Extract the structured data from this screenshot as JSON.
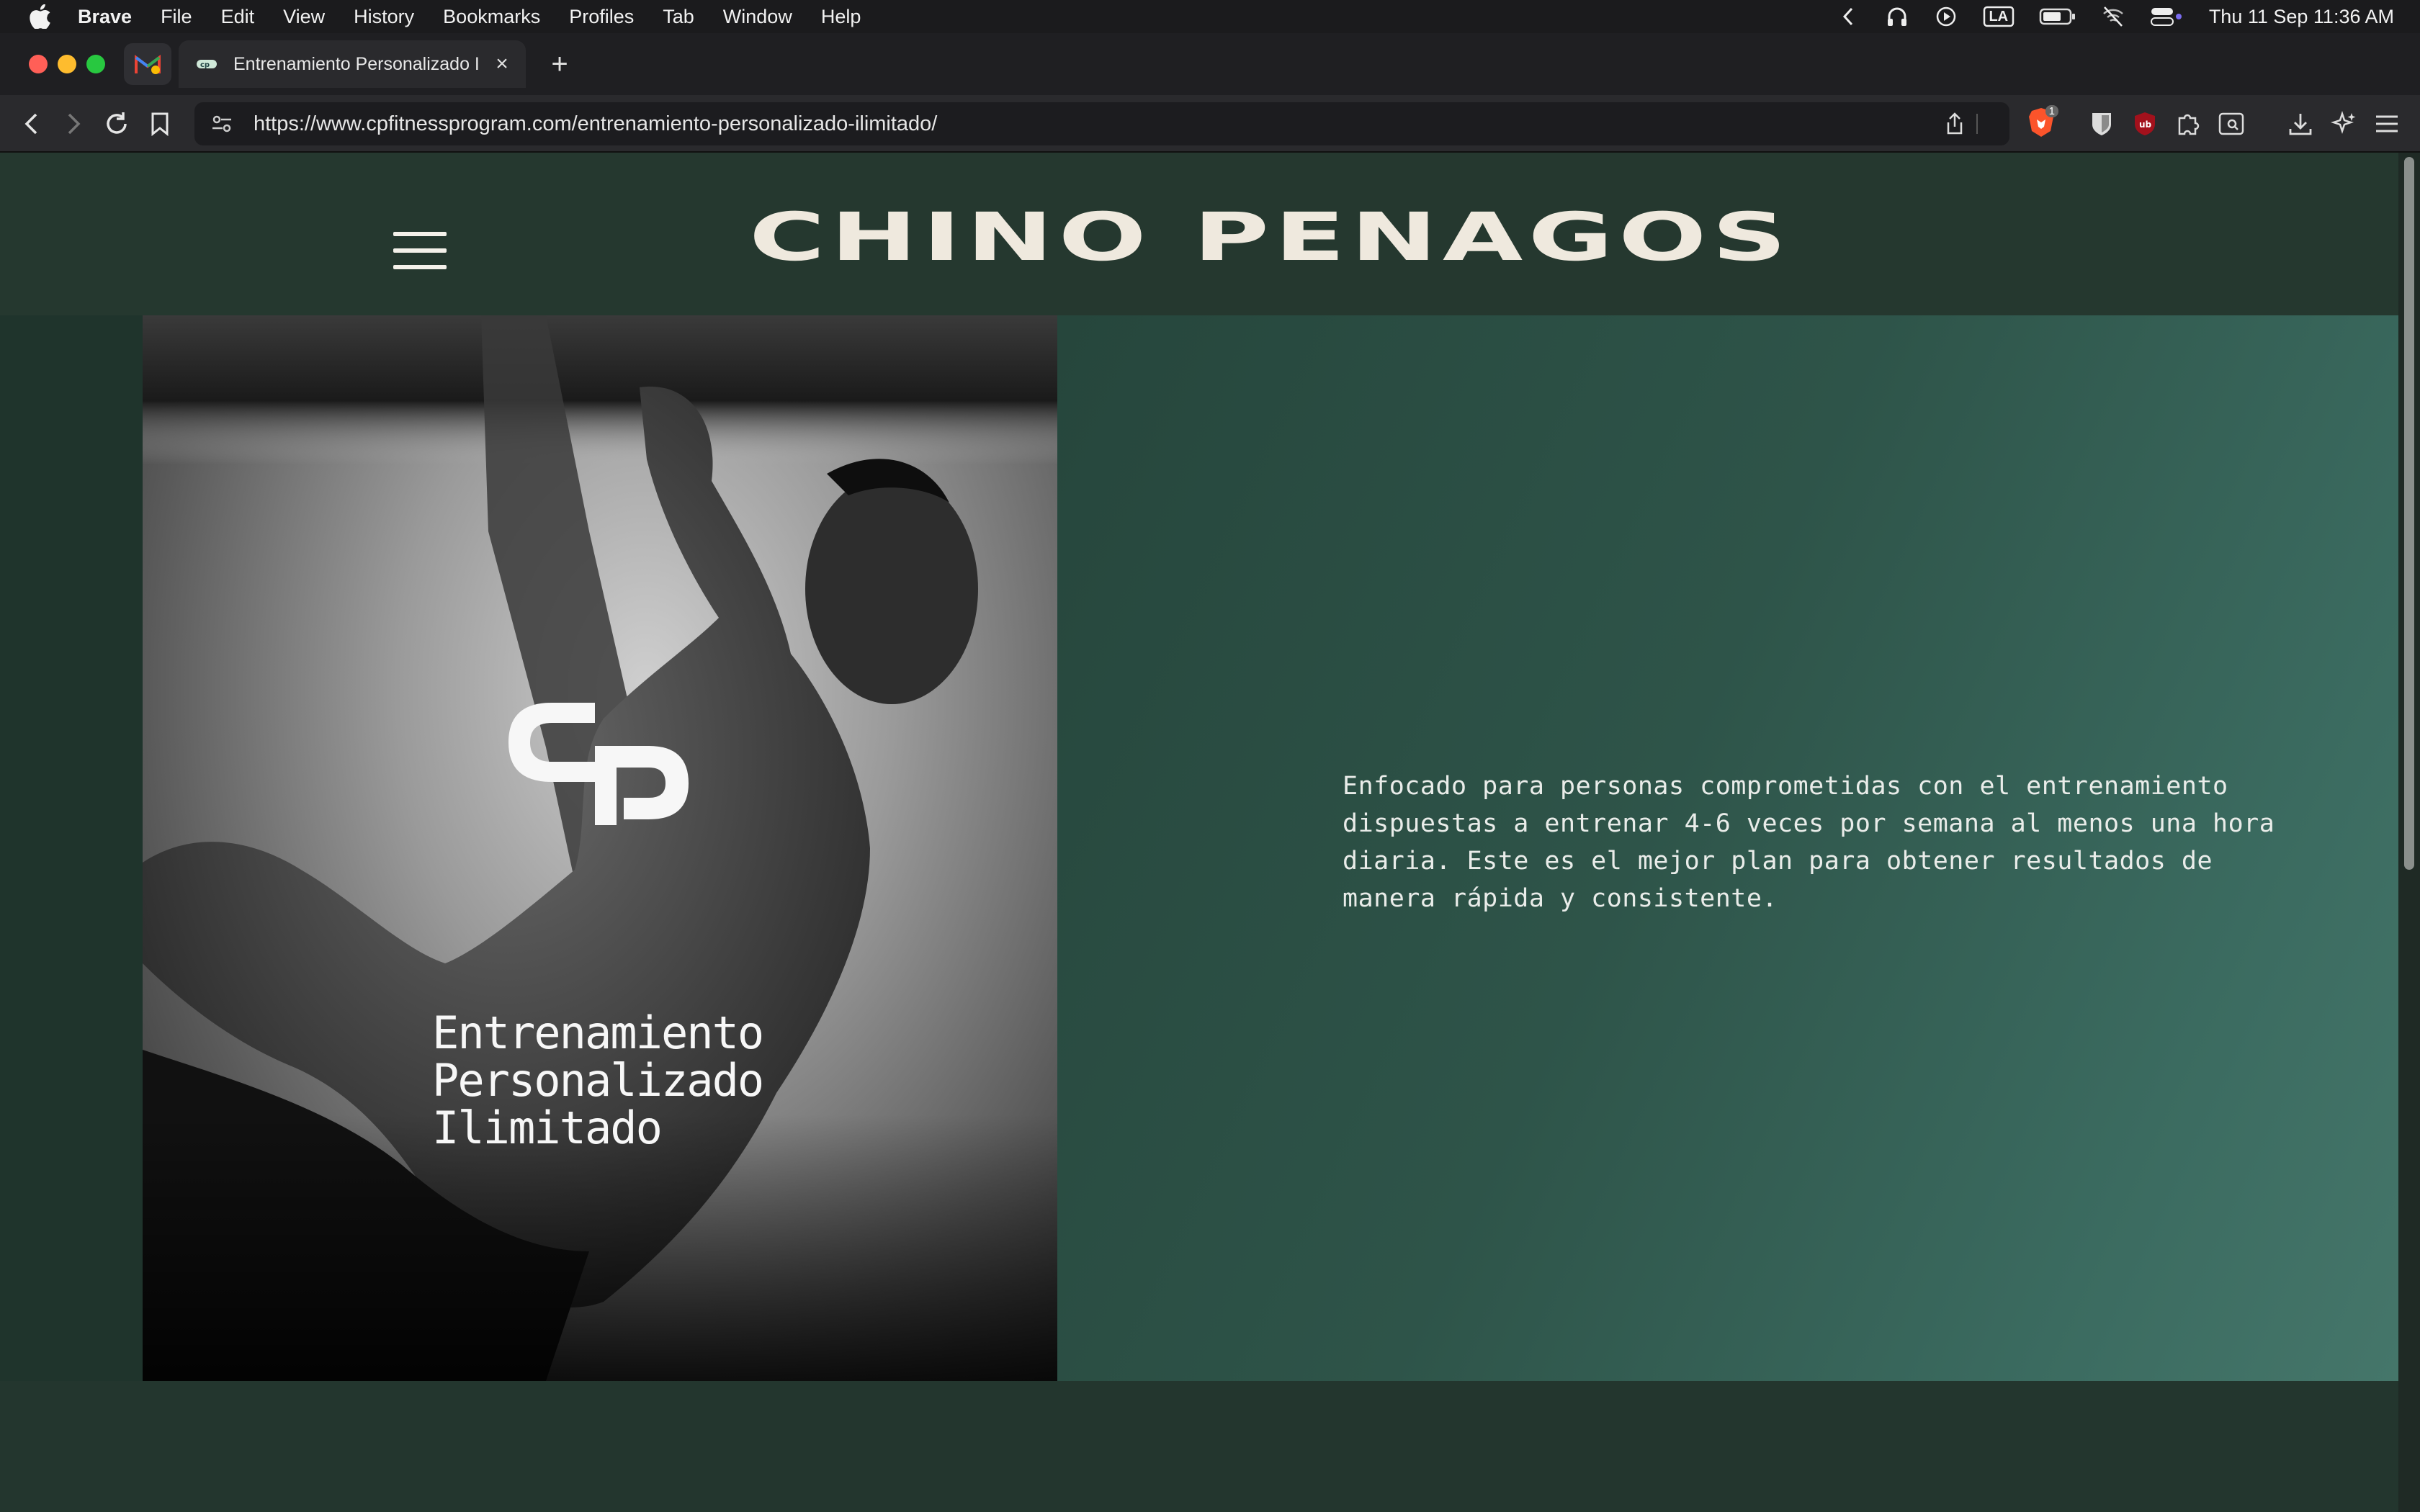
{
  "menubar": {
    "app": "Brave",
    "items": [
      "File",
      "Edit",
      "View",
      "History",
      "Bookmarks",
      "Profiles",
      "Tab",
      "Window",
      "Help"
    ],
    "status_input": "LA",
    "clock": "Thu 11 Sep  11:36 AM"
  },
  "browser": {
    "tab_title": "Entrenamiento Personalizado Ilimitado",
    "url": "https://www.cpfitnessprogram.com/entrenamiento-personalizado-ilimitado/",
    "shield_count": "1"
  },
  "site": {
    "brand": "CHINO PENAGOS",
    "hero_title_lines": [
      "Entrenamiento",
      "Personalizado",
      "Ilimitado"
    ],
    "description": "Enfocado para personas comprometidas con el entrenamiento dispuestas a entrenar 4-6 veces por semana al menos una hora diaria. Este es el mejor plan para obtener resultados de manera rápida y consistente."
  },
  "colors": {
    "header_bg": "#25382f",
    "panel_start": "#26463c",
    "panel_end": "#45766a",
    "brand_text": "#efe9de"
  }
}
